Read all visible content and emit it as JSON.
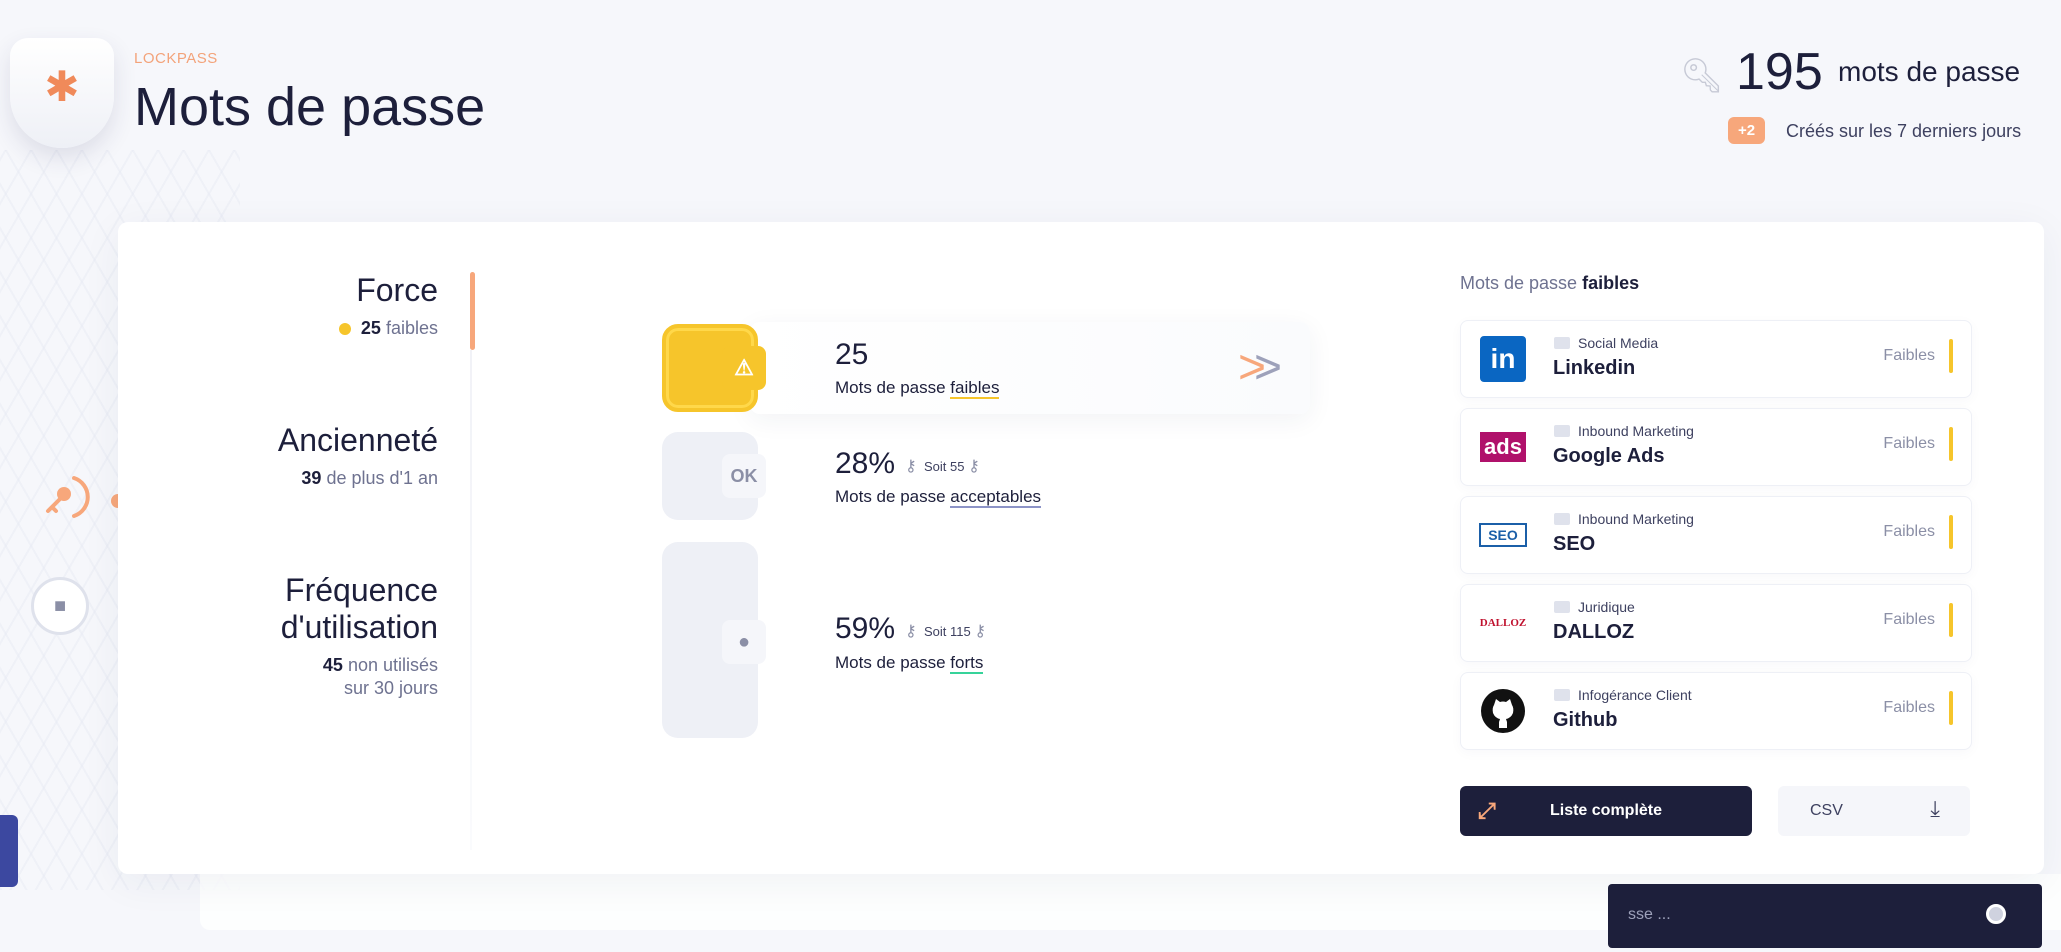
{
  "brand": "LOCKPASS",
  "page_title": "Mots de passe",
  "header": {
    "count": "195",
    "count_unit": "mots de passe",
    "badge": "+2",
    "note": "Créés sur les 7 derniers jours"
  },
  "categories": {
    "force": {
      "title": "Force",
      "count": "25",
      "label": "faibles"
    },
    "anciennete": {
      "title": "Ancienneté",
      "count": "39",
      "label": "de plus d'1 an"
    },
    "frequence": {
      "title_line1": "Fréquence",
      "title_line2": "d'utilisation",
      "count": "45",
      "label_line1": "non utilisés",
      "label_line2": "sur 30 jours"
    }
  },
  "strength": {
    "weak": {
      "value": "25",
      "label_prefix": "Mots de passe",
      "label_word": "faibles",
      "icon": "warning-icon"
    },
    "acceptable": {
      "value": "28%",
      "soit": "Soit 55",
      "label_prefix": "Mots de passe",
      "label_word": "acceptables",
      "badge": "OK"
    },
    "strong": {
      "value": "59%",
      "soit": "Soit 115",
      "label_prefix": "Mots de passe",
      "label_word": "forts",
      "icon": "bulb-icon"
    }
  },
  "list": {
    "head_prefix": "Mots de passe",
    "head_word": "faibles",
    "items": [
      {
        "category": "Social Media",
        "name": "Linkedin",
        "status": "Faibles",
        "logo": "in"
      },
      {
        "category": "Inbound Marketing",
        "name": "Google Ads",
        "status": "Faibles",
        "logo": "ads"
      },
      {
        "category": "Inbound Marketing",
        "name": "SEO",
        "status": "Faibles",
        "logo": "SEO"
      },
      {
        "category": "Juridique",
        "name": "DALLOZ",
        "status": "Faibles",
        "logo": "DALLOZ"
      },
      {
        "category": "Infogérance Client",
        "name": "Github",
        "status": "Faibles",
        "logo": "github"
      }
    ]
  },
  "buttons": {
    "full_list": "Liste complète",
    "csv": "CSV"
  },
  "search": {
    "placeholder": "sse ..."
  },
  "colors": {
    "accent": "#f7a77b",
    "navy": "#1d1f3b",
    "weak": "#f6c52b",
    "strong": "#36d39a",
    "acceptable": "#8c93c7"
  }
}
